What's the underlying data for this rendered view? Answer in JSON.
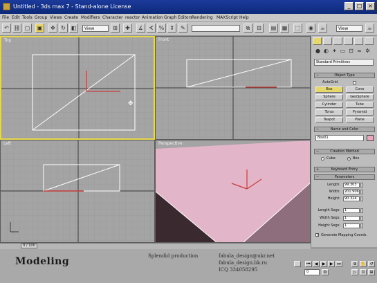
{
  "window": {
    "title": "Untitled - 3ds max 7 - Stand-alone License",
    "minimize": "_",
    "maximize": "□",
    "close": "×"
  },
  "menu": [
    "File",
    "Edit",
    "Tools",
    "Group",
    "Views",
    "Create",
    "Modifiers",
    "Character",
    "reactor",
    "Animation",
    "Graph Editors",
    "Rendering",
    "MAXScript",
    "Help"
  ],
  "toolbar": {
    "view_select": "View",
    "view_select2": "View"
  },
  "viewports": {
    "top": "Top",
    "front": "Front",
    "left": "Left",
    "perspective": "Perspective"
  },
  "command_panel": {
    "category_dropdown": "Standard Primitives",
    "object_type_header": "Object Type",
    "autogrid_label": "AutoGrid",
    "object_buttons": [
      "Box",
      "Cone",
      "Sphere",
      "GeoSphere",
      "Cylinder",
      "Tube",
      "Torus",
      "Pyramid",
      "Teapot",
      "Plane"
    ],
    "name_color_header": "Name and Color",
    "name_value": "Box01",
    "creation_method_header": "Creation Method",
    "creation_cube": "Cube",
    "creation_box": "Box",
    "keyboard_entry_header": "Keyboard Entry",
    "parameters_header": "Parameters",
    "params": [
      {
        "label": "Length:",
        "value": "99.303"
      },
      {
        "label": "Width:",
        "value": "201.906"
      },
      {
        "label": "Height:",
        "value": "90.324"
      },
      {
        "label": "Length Segs:",
        "value": "1"
      },
      {
        "label": "Width Segs:",
        "value": "1"
      },
      {
        "label": "Height Segs:",
        "value": "1"
      }
    ],
    "generate_mapping": "Generate Mapping Coords."
  },
  "timeline": {
    "frame_label": "0 / 100"
  },
  "status": {
    "watermark_title": "Modeling",
    "watermark_lines": [
      "Splendid production",
      "fabula_design@ukr.net",
      "fabula_design.bk.ru",
      "ICQ 334058295"
    ],
    "frame_value": "0"
  },
  "colors": {
    "viewport_bg": "#a4a4a4",
    "active_border": "#e6d84a",
    "object_pink": "#e3b5c8",
    "axis_red": "#c83c3c"
  }
}
